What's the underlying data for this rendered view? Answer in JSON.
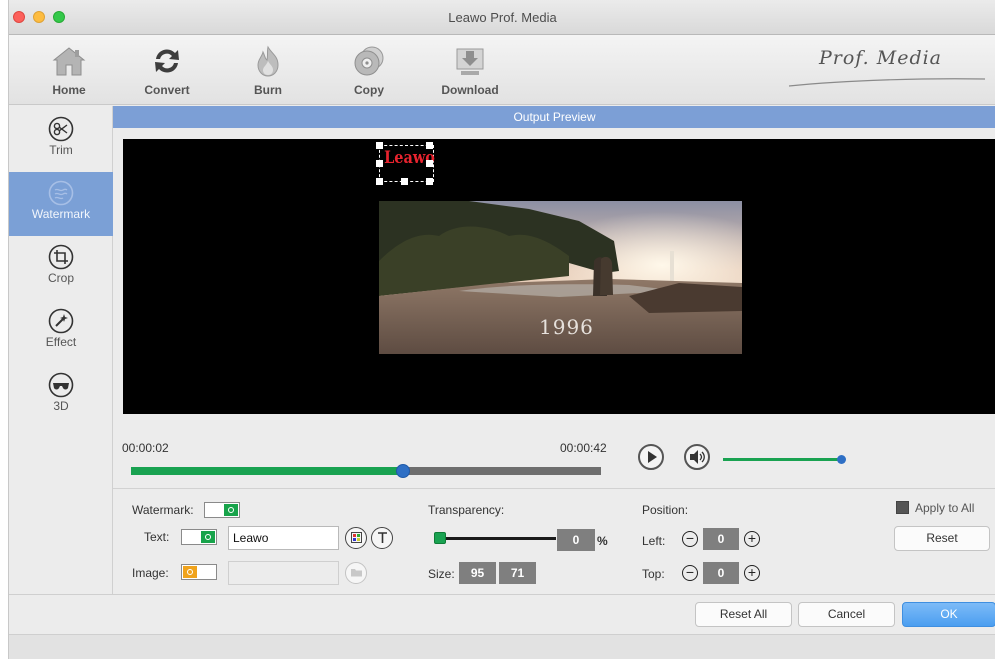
{
  "window": {
    "title": "Leawo Prof. Media"
  },
  "toolbar": {
    "items": [
      {
        "label": "Home",
        "icon": "home-icon"
      },
      {
        "label": "Convert",
        "icon": "convert-icon"
      },
      {
        "label": "Burn",
        "icon": "burn-icon"
      },
      {
        "label": "Copy",
        "icon": "copy-icon"
      },
      {
        "label": "Download",
        "icon": "download-icon"
      }
    ],
    "brand": "Prof. Media"
  },
  "sidebar": {
    "items": [
      {
        "label": "Trim",
        "icon": "scissors-icon",
        "active": false
      },
      {
        "label": "Watermark",
        "icon": "watermark-icon",
        "active": true
      },
      {
        "label": "Crop",
        "icon": "crop-icon",
        "active": false
      },
      {
        "label": "Effect",
        "icon": "effect-icon",
        "active": false
      },
      {
        "label": "3D",
        "icon": "3d-glasses-icon",
        "active": false
      }
    ]
  },
  "preview": {
    "header": "Output Preview",
    "watermark_text": "Leawo",
    "video_caption": "1996"
  },
  "playback": {
    "current_time": "00:00:02",
    "total_time": "00:00:42",
    "progress_fraction": 0.578,
    "volume_fraction": 0.95
  },
  "settings": {
    "watermark_label": "Watermark:",
    "watermark_enabled": true,
    "text_label": "Text:",
    "text_enabled": true,
    "text_value": "Leawo",
    "image_label": "Image:",
    "image_enabled": false,
    "image_value": "",
    "transparency_label": "Transparency:",
    "transparency_value": "0",
    "transparency_unit": "%",
    "size_label": "Size:",
    "size_width": "95",
    "size_height": "71",
    "position_label": "Position:",
    "left_label": "Left:",
    "left_value": "0",
    "top_label": "Top:",
    "top_value": "0",
    "apply_all_label": "Apply to All",
    "apply_all_checked": true,
    "reset_label": "Reset"
  },
  "footer": {
    "reset_all_label": "Reset All",
    "cancel_label": "Cancel",
    "ok_label": "OK"
  },
  "colors": {
    "accent_blue": "#7c9fd6",
    "progress_green": "#19a251",
    "knob_blue": "#2e6fc5",
    "watermark_red": "#e8232e"
  }
}
